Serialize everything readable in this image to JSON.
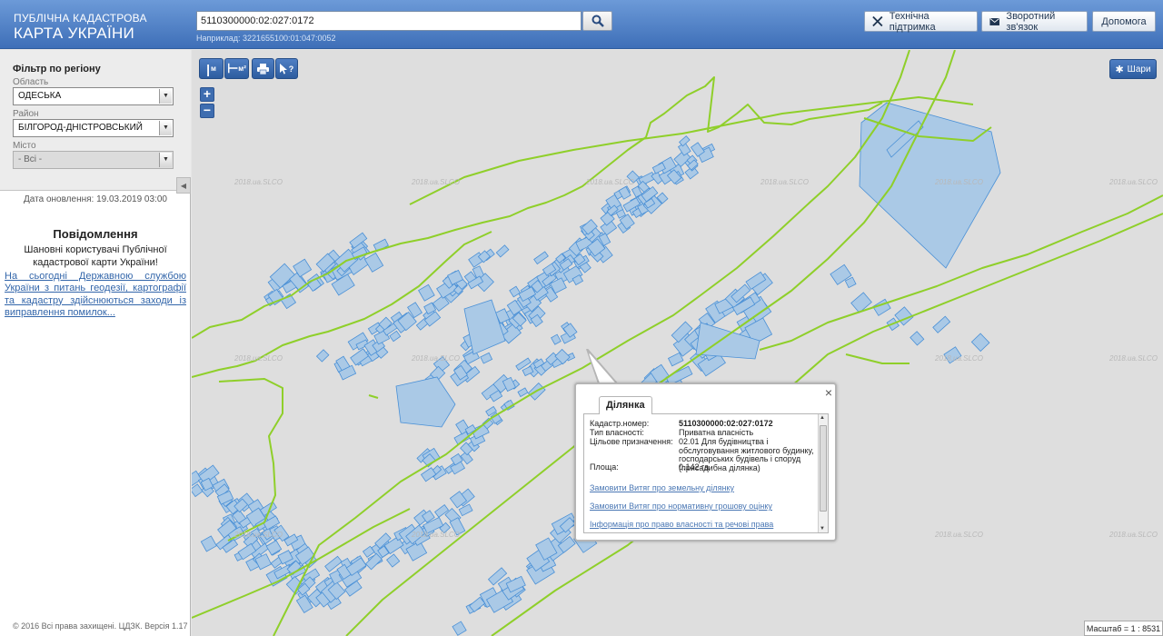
{
  "header": {
    "logo_line1": "ПУБЛІЧНА КАДАСТРОВА",
    "logo_line2": "КАРТА УКРАЇНИ",
    "search_value": "5110300000:02:027:0172",
    "search_hint": "Наприклад: 3221655100:01:047:0052",
    "buttons": {
      "support": "Технічна підтримка",
      "feedback": "Зворотний зв'язок",
      "help": "Допомога"
    }
  },
  "sidebar": {
    "filter_title": "Фільтр по регіону",
    "oblast_label": "Область",
    "oblast_value": "ОДЕСЬКА",
    "rayon_label": "Район",
    "rayon_value": "БІЛГОРОД-ДНІСТРОВСЬКИЙ",
    "city_label": "Місто",
    "city_value": "- Всі -",
    "updated": "Дата оновлення: 19.03.2019 03:00",
    "notification_title": "Повідомлення",
    "notification_text": "Шановні користувачі Публічної кадастрової карти України!",
    "notification_link": "На сьогодні Державною службою України з питань геодезії, картографії та кадастру здійснюються заходи із виправлення помилок...",
    "copyright": "© 2016 Всі права захищені. ЦДЗК. Версія 1.17"
  },
  "map": {
    "tools": {
      "measure_line": "м",
      "measure_area": "м²",
      "info": "?"
    },
    "zoom_in": "+",
    "zoom_out": "−",
    "layers_label": "Шари",
    "watermark": "2018.ua.SLCO",
    "scale": "Масштаб = 1 : 8531",
    "colors": {
      "parcel_fill": "#aac9e6",
      "parcel_stroke": "#4a90d6",
      "boundary": "#8fcf2a",
      "background": "#dedede"
    }
  },
  "popup": {
    "tab": "Ділянка",
    "close": "×",
    "rows": [
      {
        "key": "Кадастр.номер:",
        "value": "5110300000:02:027:0172"
      },
      {
        "key": "Тип власності:",
        "value": "Приватна власність"
      },
      {
        "key": "Цільове призначення:",
        "value": "02.01 Для будівництва і обслуговування житлового будинку, господарських будівель і споруд (присадибна ділянка)"
      },
      {
        "key": "Площа:",
        "value": "0.142 га"
      }
    ],
    "links": [
      "Замовити Витяг про земельну ділянку",
      "Замовити Витяг про нормативну грошову оцінку",
      "Інформація про право власності та речові права"
    ]
  }
}
